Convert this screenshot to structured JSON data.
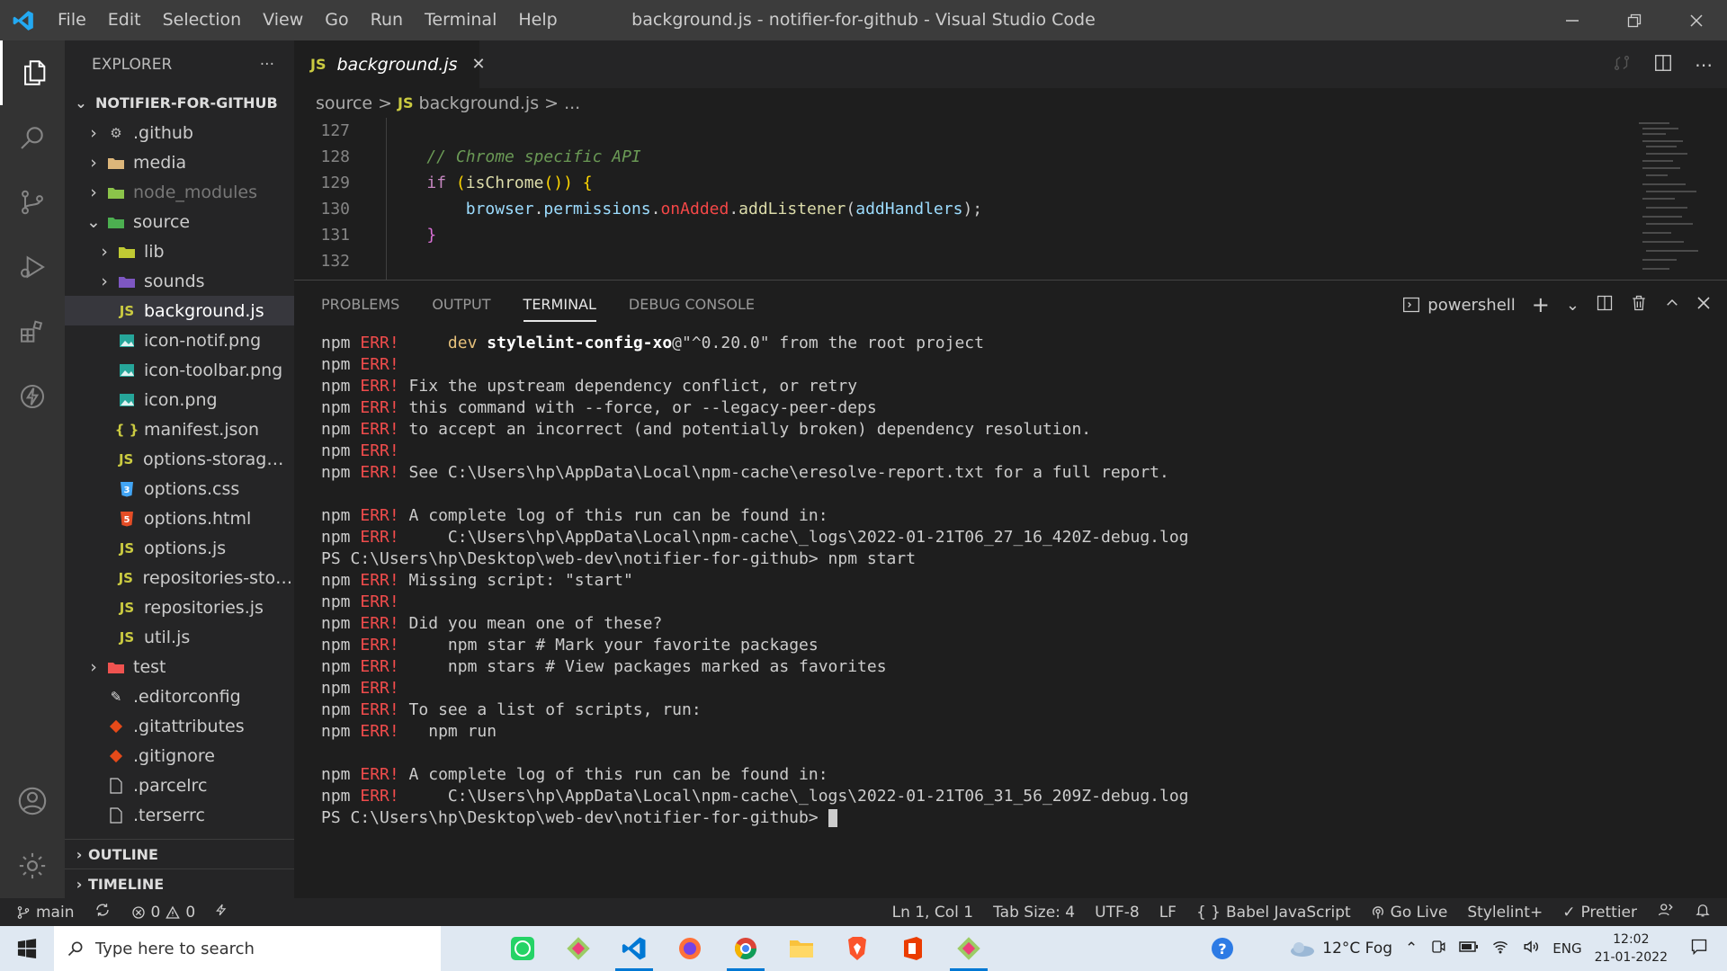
{
  "window_title": "background.js - notifier-for-github - Visual Studio Code",
  "menus": [
    "File",
    "Edit",
    "Selection",
    "View",
    "Go",
    "Run",
    "Terminal",
    "Help"
  ],
  "sidebar": {
    "title": "EXPLORER",
    "more": "···",
    "project": "NOTIFIER-FOR-GITHUB",
    "items": [
      {
        "label": ".github"
      },
      {
        "label": "media"
      },
      {
        "label": "node_modules"
      },
      {
        "label": "source"
      },
      {
        "label": "lib"
      },
      {
        "label": "sounds"
      },
      {
        "label": "background.js"
      },
      {
        "label": "icon-notif.png"
      },
      {
        "label": "icon-toolbar.png"
      },
      {
        "label": "icon.png"
      },
      {
        "label": "manifest.json"
      },
      {
        "label": "options-storage.js"
      },
      {
        "label": "options.css"
      },
      {
        "label": "options.html"
      },
      {
        "label": "options.js"
      },
      {
        "label": "repositories-stor..."
      },
      {
        "label": "repositories.js"
      },
      {
        "label": "util.js"
      },
      {
        "label": "test"
      },
      {
        "label": ".editorconfig"
      },
      {
        "label": ".gitattributes"
      },
      {
        "label": ".gitignore"
      },
      {
        "label": ".parcelrc"
      },
      {
        "label": ".terserrc"
      }
    ],
    "outline": "OUTLINE",
    "timeline": "TIMELINE"
  },
  "editor": {
    "tab_label": "background.js",
    "js_badge": "JS",
    "breadcrumb": {
      "folder": "source",
      "sep": ">",
      "file": "background.js",
      "tail": "> ..."
    },
    "lines": [
      {
        "n": "127",
        "text": ""
      },
      {
        "n": "128",
        "text": "    // Chrome specific API"
      },
      {
        "n": "129",
        "text": "    if (isChrome()) {"
      },
      {
        "n": "130",
        "text": "        browser.permissions.onAdded.addListener(addHandlers);"
      },
      {
        "n": "131",
        "text": "    }"
      },
      {
        "n": "132",
        "text": ""
      }
    ]
  },
  "panel": {
    "tabs": [
      "PROBLEMS",
      "OUTPUT",
      "TERMINAL",
      "DEBUG CONSOLE"
    ],
    "shell": "powershell",
    "terminal": [
      {
        "p": "npm ",
        "e": "ERR!",
        "t": "     dev stylelint-config-xo@\"^0.20.0\" from the root project"
      },
      {
        "p": "npm ",
        "e": "ERR!",
        "t": ""
      },
      {
        "p": "npm ",
        "e": "ERR!",
        "t": " Fix the upstream dependency conflict, or retry"
      },
      {
        "p": "npm ",
        "e": "ERR!",
        "t": " this command with --force, or --legacy-peer-deps"
      },
      {
        "p": "npm ",
        "e": "ERR!",
        "t": " to accept an incorrect (and potentially broken) dependency resolution."
      },
      {
        "p": "npm ",
        "e": "ERR!",
        "t": ""
      },
      {
        "p": "npm ",
        "e": "ERR!",
        "t": " See C:\\Users\\hp\\AppData\\Local\\npm-cache\\eresolve-report.txt for a full report."
      },
      {
        "p": "",
        "e": "",
        "t": ""
      },
      {
        "p": "npm ",
        "e": "ERR!",
        "t": " A complete log of this run can be found in:"
      },
      {
        "p": "npm ",
        "e": "ERR!",
        "t": "     C:\\Users\\hp\\AppData\\Local\\npm-cache\\_logs\\2022-01-21T06_27_16_420Z-debug.log"
      },
      {
        "p": "PS C:\\Users\\hp\\Desktop\\web-dev\\notifier-for-github> npm start",
        "e": "",
        "t": ""
      },
      {
        "p": "npm ",
        "e": "ERR!",
        "t": " Missing script: \"start\""
      },
      {
        "p": "npm ",
        "e": "ERR!",
        "t": ""
      },
      {
        "p": "npm ",
        "e": "ERR!",
        "t": " Did you mean one of these?"
      },
      {
        "p": "npm ",
        "e": "ERR!",
        "t": "     npm star # Mark your favorite packages"
      },
      {
        "p": "npm ",
        "e": "ERR!",
        "t": "     npm stars # View packages marked as favorites"
      },
      {
        "p": "npm ",
        "e": "ERR!",
        "t": ""
      },
      {
        "p": "npm ",
        "e": "ERR!",
        "t": " To see a list of scripts, run:"
      },
      {
        "p": "npm ",
        "e": "ERR!",
        "t": "   npm run"
      },
      {
        "p": "",
        "e": "",
        "t": ""
      },
      {
        "p": "npm ",
        "e": "ERR!",
        "t": " A complete log of this run can be found in:"
      },
      {
        "p": "npm ",
        "e": "ERR!",
        "t": "     C:\\Users\\hp\\AppData\\Local\\npm-cache\\_logs\\2022-01-21T06_31_56_209Z-debug.log"
      },
      {
        "p": "PS C:\\Users\\hp\\Desktop\\web-dev\\notifier-for-github> ",
        "e": "",
        "t": ""
      }
    ]
  },
  "status": {
    "branch": "main",
    "errors": "0",
    "warnings": "0",
    "position": "Ln 1, Col 1",
    "tab_size": "Tab Size: 4",
    "encoding": "UTF-8",
    "eol": "LF",
    "language": "Babel JavaScript",
    "golive": "Go Live",
    "stylelint": "Stylelint+",
    "prettier": "Prettier"
  },
  "taskbar": {
    "search_placeholder": "Type here to search",
    "weather": "12°C  Fog",
    "lang": "ENG",
    "time": "12:02",
    "date": "21-01-2022"
  },
  "colors": {
    "accent": "#007acc",
    "error": "#f14c4c",
    "js": "#cbcb41"
  }
}
